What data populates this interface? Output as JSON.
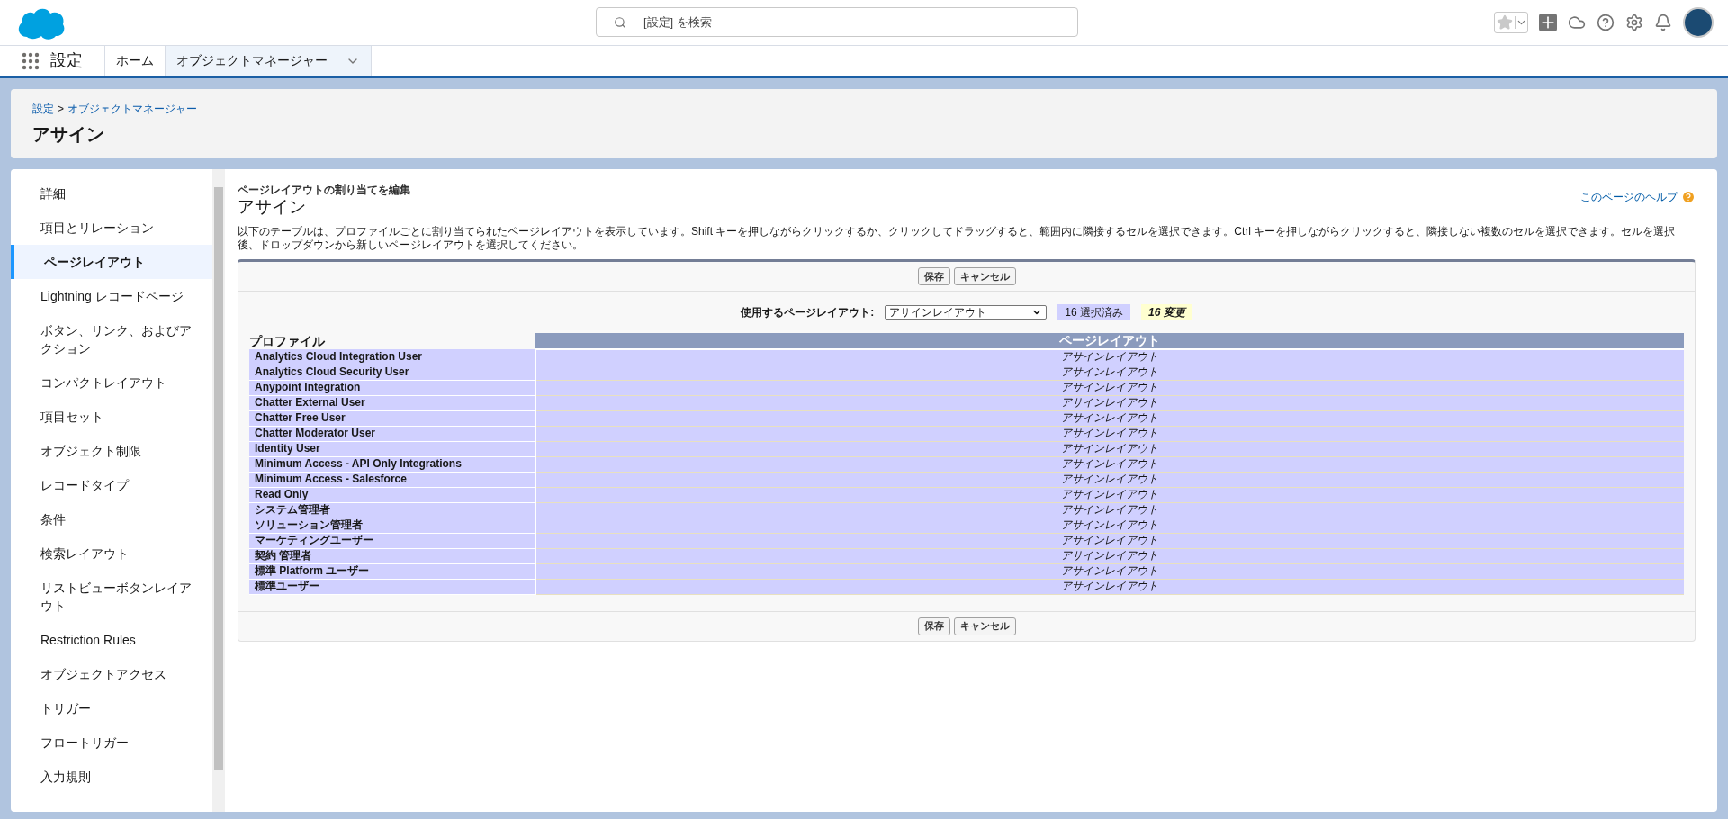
{
  "global_header": {
    "search": {
      "placeholder": "[設定] を検索"
    }
  },
  "nav_bar": {
    "app_name": "設定",
    "tabs": [
      {
        "label": "ホーム",
        "selected": false
      },
      {
        "label": "オブジェクトマネージャー",
        "selected": true
      }
    ]
  },
  "page_header": {
    "breadcrumb": [
      "設定",
      "オブジェクトマネージャー"
    ],
    "breadcrumb_separator": ">",
    "title": "アサイン"
  },
  "sidebar": {
    "items": [
      {
        "label": "詳細",
        "selected": false
      },
      {
        "label": "項目とリレーション",
        "selected": false
      },
      {
        "label": "ページレイアウト",
        "selected": true
      },
      {
        "label": "Lightning レコードページ",
        "selected": false
      },
      {
        "label": "ボタン、リンク、およびアクション",
        "selected": false
      },
      {
        "label": "コンパクトレイアウト",
        "selected": false
      },
      {
        "label": "項目セット",
        "selected": false
      },
      {
        "label": "オブジェクト制限",
        "selected": false
      },
      {
        "label": "レコードタイプ",
        "selected": false
      },
      {
        "label": "条件",
        "selected": false
      },
      {
        "label": "検索レイアウト",
        "selected": false
      },
      {
        "label": "リストビューボタンレイアウト",
        "selected": false
      },
      {
        "label": "Restriction Rules",
        "selected": false
      },
      {
        "label": "オブジェクトアクセス",
        "selected": false
      },
      {
        "label": "トリガー",
        "selected": false
      },
      {
        "label": "フロートリガー",
        "selected": false
      },
      {
        "label": "入力規則",
        "selected": false
      }
    ]
  },
  "content": {
    "subtitle": "ページレイアウトの割り当てを編集",
    "title": "アサイン",
    "help_link": "このページのヘルプ",
    "description": "以下のテーブルは、プロファイルごとに割り当てられたページレイアウトを表示しています。Shift キーを押しながらクリックするか、クリックしてドラッグすると、範囲内に隣接するセルを選択できます。Ctrl キーを押しながらクリックすると、隣接しない複数のセルを選択できます。セルを選択後、ドロップダウンから新しいページレイアウトを選択してください。",
    "top_buttons": [
      "保存",
      "キャンセル"
    ],
    "layout_picker": {
      "label": "使用するページレイアウト:",
      "value": "アサインレイアウト",
      "selected_count": "16 選択済み",
      "changed_count": "16 変更"
    },
    "table": {
      "columns": [
        "プロファイル",
        "ページレイアウト"
      ],
      "rows": [
        {
          "profile": "Analytics Cloud Integration User",
          "layout": "アサインレイアウト",
          "selected": true
        },
        {
          "profile": "Analytics Cloud Security User",
          "layout": "アサインレイアウト",
          "selected": true
        },
        {
          "profile": "Anypoint Integration",
          "layout": "アサインレイアウト",
          "selected": true
        },
        {
          "profile": "Chatter External User",
          "layout": "アサインレイアウト",
          "selected": true
        },
        {
          "profile": "Chatter Free User",
          "layout": "アサインレイアウト",
          "selected": true
        },
        {
          "profile": "Chatter Moderator User",
          "layout": "アサインレイアウト",
          "selected": true
        },
        {
          "profile": "Identity User",
          "layout": "アサインレイアウト",
          "selected": true
        },
        {
          "profile": "Minimum Access - API Only Integrations",
          "layout": "アサインレイアウト",
          "selected": true
        },
        {
          "profile": "Minimum Access - Salesforce",
          "layout": "アサインレイアウト",
          "selected": true
        },
        {
          "profile": "Read Only",
          "layout": "アサインレイアウト",
          "selected": true
        },
        {
          "profile": "システム管理者",
          "layout": "アサインレイアウト",
          "selected": true
        },
        {
          "profile": "ソリューション管理者",
          "layout": "アサインレイアウト",
          "selected": true
        },
        {
          "profile": "マーケティングユーザー",
          "layout": "アサインレイアウト",
          "selected": true
        },
        {
          "profile": "契約 管理者",
          "layout": "アサインレイアウト",
          "selected": true
        },
        {
          "profile": "標準 Platform ユーザー",
          "layout": "アサインレイアウト",
          "selected": true
        },
        {
          "profile": "標準ユーザー",
          "layout": "アサインレイアウト",
          "selected": true
        }
      ]
    },
    "bottom_buttons": [
      "保存",
      "キャンセル"
    ]
  }
}
